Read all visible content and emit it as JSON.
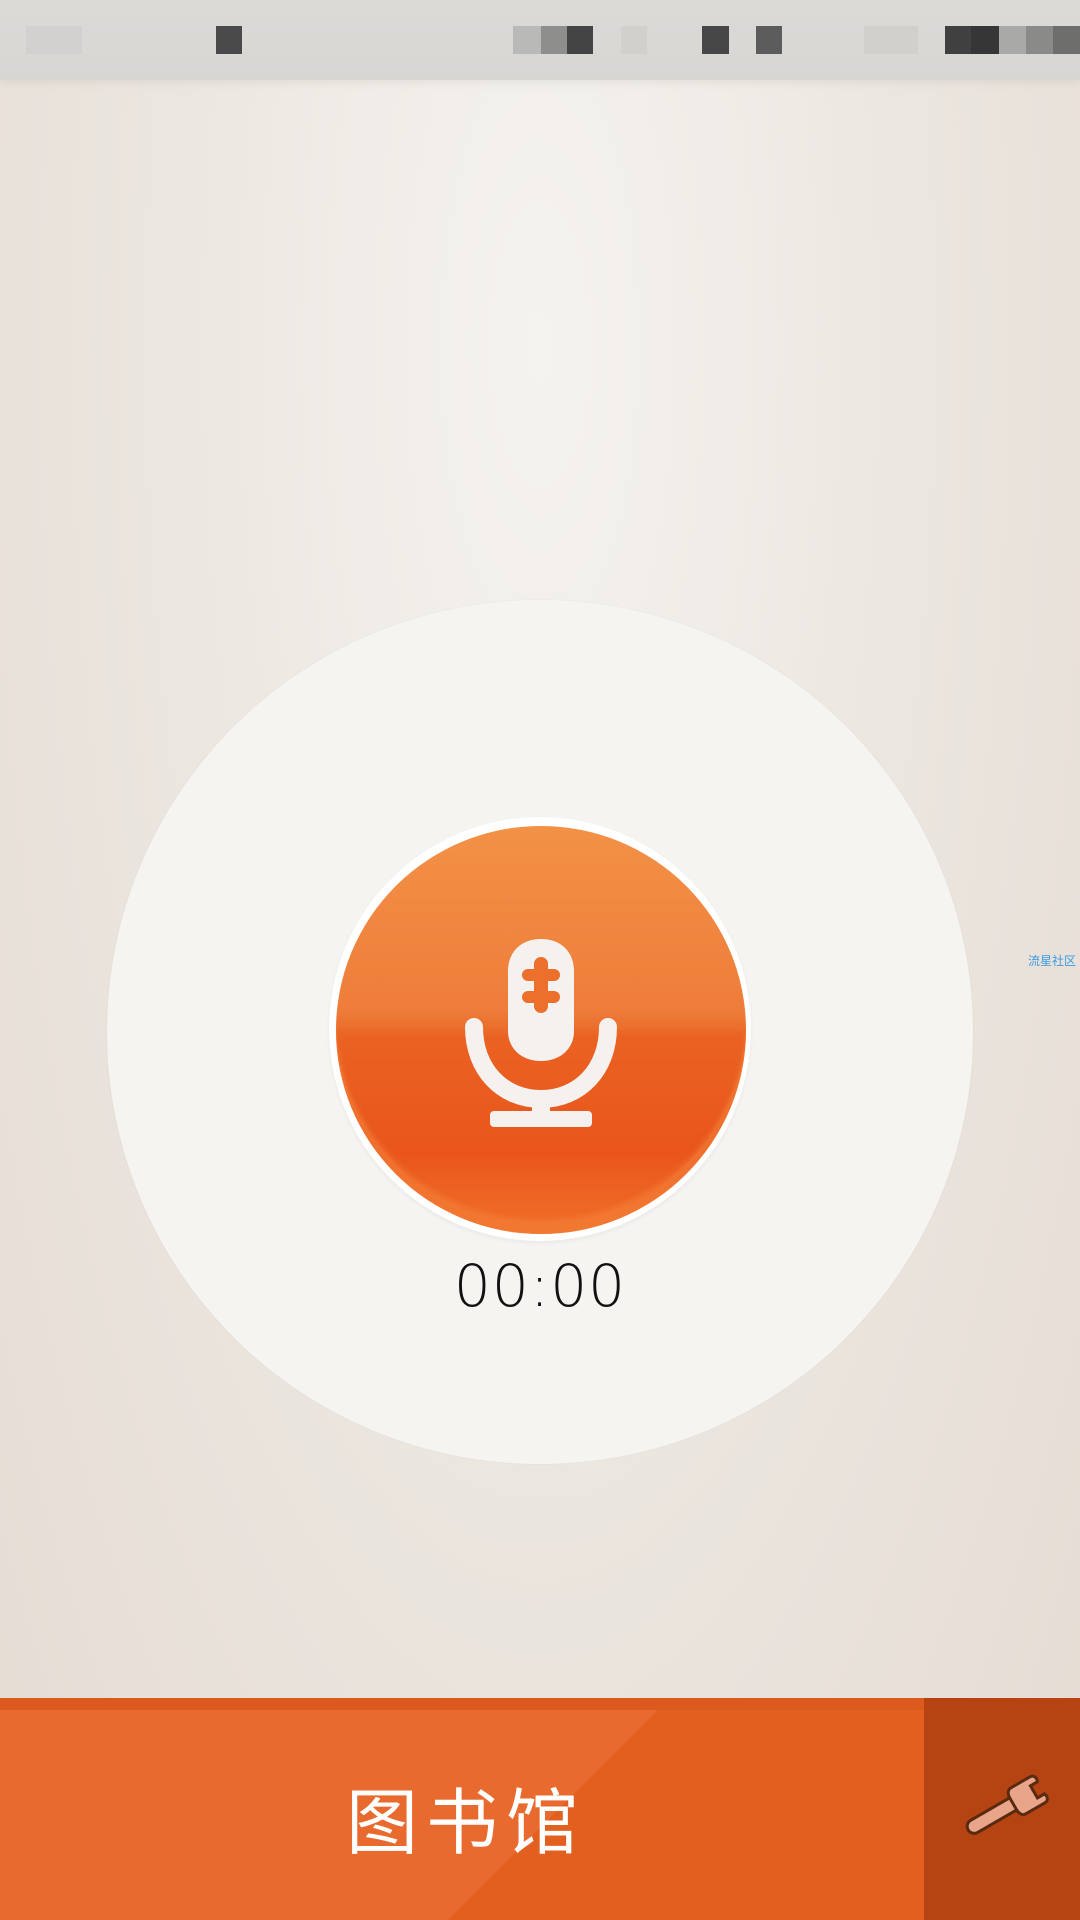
{
  "status_bar": {
    "redacted": true
  },
  "recorder": {
    "icon": "microphone-icon",
    "timer": "00:00"
  },
  "watermark": {
    "text": "流星社区"
  },
  "bottom_bar": {
    "library_label": "图书馆",
    "settings_icon": "wrench-icon"
  },
  "colors": {
    "accent": "#ef6d22",
    "accent_dark": "#b64412",
    "background": "#ece7e1"
  }
}
